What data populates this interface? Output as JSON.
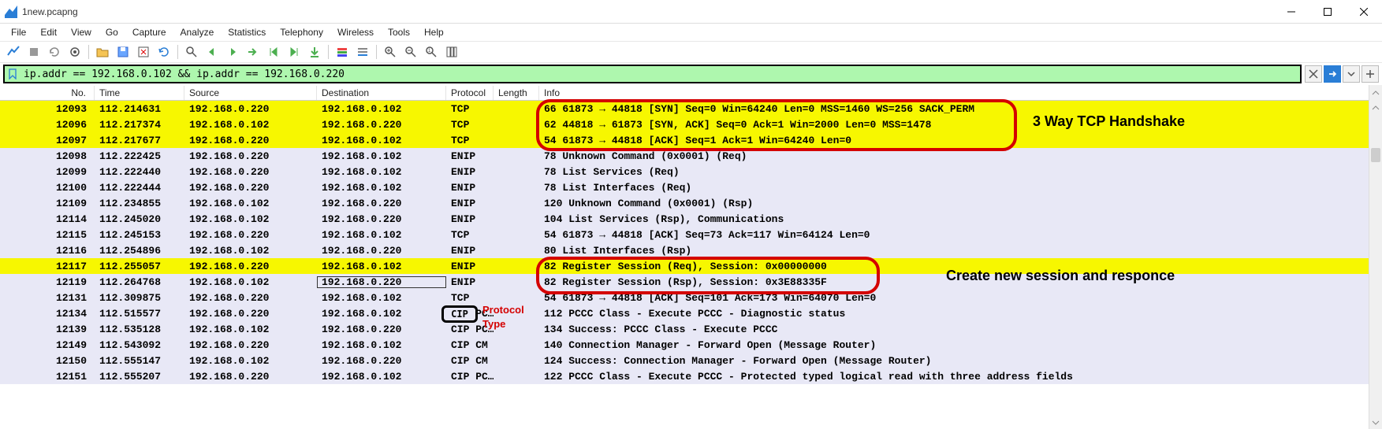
{
  "title": "1new.pcapng",
  "menu": [
    "File",
    "Edit",
    "View",
    "Go",
    "Capture",
    "Analyze",
    "Statistics",
    "Telephony",
    "Wireless",
    "Tools",
    "Help"
  ],
  "filter": {
    "value": "ip.addr == 192.168.0.102 && ip.addr == 192.168.0.220"
  },
  "columns": {
    "no": "No.",
    "time": "Time",
    "src": "Source",
    "dst": "Destination",
    "proto": "Protocol",
    "len": "Length",
    "info": "Info"
  },
  "rows": [
    {
      "no": "12093",
      "time": "112.214631",
      "src": "192.168.0.220",
      "dst": "192.168.0.102",
      "proto": "TCP",
      "len": "66",
      "info": "61873 → 44818 [SYN] Seq=0 Win=64240 Len=0 MSS=1460 WS=256 SACK_PERM",
      "style": "hl",
      "bold": true
    },
    {
      "no": "12096",
      "time": "112.217374",
      "src": "192.168.0.102",
      "dst": "192.168.0.220",
      "proto": "TCP",
      "len": "62",
      "info": "44818 → 61873 [SYN, ACK] Seq=0 Ack=1 Win=2000 Len=0 MSS=1478",
      "style": "hl",
      "bold": true
    },
    {
      "no": "12097",
      "time": "112.217677",
      "src": "192.168.0.220",
      "dst": "192.168.0.102",
      "proto": "TCP",
      "len": "54",
      "info": "61873 → 44818 [ACK] Seq=1 Ack=1 Win=64240 Len=0",
      "style": "hl",
      "bold": true
    },
    {
      "no": "12098",
      "time": "112.222425",
      "src": "192.168.0.220",
      "dst": "192.168.0.102",
      "proto": "ENIP",
      "len": "78",
      "info": "Unknown Command (0x0001) (Req)",
      "style": "normal",
      "bold": true
    },
    {
      "no": "12099",
      "time": "112.222440",
      "src": "192.168.0.220",
      "dst": "192.168.0.102",
      "proto": "ENIP",
      "len": "78",
      "info": "List Services (Req)",
      "style": "normal",
      "bold": true
    },
    {
      "no": "12100",
      "time": "112.222444",
      "src": "192.168.0.220",
      "dst": "192.168.0.102",
      "proto": "ENIP",
      "len": "78",
      "info": "List Interfaces (Req)",
      "style": "normal",
      "bold": true
    },
    {
      "no": "12109",
      "time": "112.234855",
      "src": "192.168.0.102",
      "dst": "192.168.0.220",
      "proto": "ENIP",
      "len": "120",
      "info": "Unknown Command (0x0001) (Rsp)",
      "style": "normal",
      "bold": true
    },
    {
      "no": "12114",
      "time": "112.245020",
      "src": "192.168.0.102",
      "dst": "192.168.0.220",
      "proto": "ENIP",
      "len": "104",
      "info": "List Services (Rsp), Communications",
      "style": "normal",
      "bold": true
    },
    {
      "no": "12115",
      "time": "112.245153",
      "src": "192.168.0.220",
      "dst": "192.168.0.102",
      "proto": "TCP",
      "len": "54",
      "info": "61873 → 44818 [ACK] Seq=73 Ack=117 Win=64124 Len=0",
      "style": "normal",
      "bold": true
    },
    {
      "no": "12116",
      "time": "112.254896",
      "src": "192.168.0.102",
      "dst": "192.168.0.220",
      "proto": "ENIP",
      "len": "80",
      "info": "List Interfaces (Rsp)",
      "style": "normal",
      "bold": true
    },
    {
      "no": "12117",
      "time": "112.255057",
      "src": "192.168.0.220",
      "dst": "192.168.0.102",
      "proto": "ENIP",
      "len": "82",
      "info": "Register Session (Req), Session: 0x00000000",
      "style": "hl",
      "bold": true
    },
    {
      "no": "12119",
      "time": "112.264768",
      "src": "192.168.0.102",
      "dst": "192.168.0.220",
      "proto": "ENIP",
      "len": "82",
      "info": "Register Session (Rsp), Session: 0x3E88335F",
      "style": "hl",
      "bold": true,
      "sel": true
    },
    {
      "no": "12131",
      "time": "112.309875",
      "src": "192.168.0.220",
      "dst": "192.168.0.102",
      "proto": "TCP",
      "len": "54",
      "info": "61873 → 44818 [ACK] Seq=101 Ack=173 Win=64070 Len=0",
      "style": "normal",
      "bold": true
    },
    {
      "no": "12134",
      "time": "112.515577",
      "src": "192.168.0.220",
      "dst": "192.168.0.102",
      "proto": "CIP PC…",
      "len": "112",
      "info": "PCCC Class - Execute PCCC - Diagnostic status",
      "style": "normal",
      "bold": true
    },
    {
      "no": "12139",
      "time": "112.535128",
      "src": "192.168.0.102",
      "dst": "192.168.0.220",
      "proto": "CIP PC…",
      "len": "134",
      "info": "Success: PCCC Class - Execute PCCC",
      "style": "normal",
      "bold": true
    },
    {
      "no": "12149",
      "time": "112.543092",
      "src": "192.168.0.220",
      "dst": "192.168.0.102",
      "proto": "CIP CM",
      "len": "140",
      "info": "Connection Manager - Forward Open (Message Router)",
      "style": "normal",
      "bold": true
    },
    {
      "no": "12150",
      "time": "112.555147",
      "src": "192.168.0.102",
      "dst": "192.168.0.220",
      "proto": "CIP CM",
      "len": "124",
      "info": "Success: Connection Manager - Forward Open (Message Router)",
      "style": "normal",
      "bold": true
    },
    {
      "no": "12151",
      "time": "112.555207",
      "src": "192.168.0.220",
      "dst": "192.168.0.102",
      "proto": "CIP PC…",
      "len": "122",
      "info": "PCCC Class - Execute PCCC - Protected typed logical read with three address fields",
      "style": "normal",
      "bold": true
    }
  ],
  "annotations": {
    "tcp_handshake": "3 Way TCP Handshake",
    "session": "Create new session and responce",
    "protocol": "Protocol",
    "type": "Type",
    "cip": "CIP"
  }
}
